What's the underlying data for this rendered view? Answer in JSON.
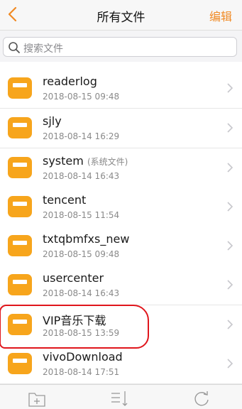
{
  "header": {
    "title": "所有文件",
    "edit_label": "编辑"
  },
  "search": {
    "placeholder": "搜索文件"
  },
  "files": [
    {
      "name": "readerlog",
      "date": "2018-08-15 09:48"
    },
    {
      "name": "sjly",
      "date": "2018-08-14 16:29"
    },
    {
      "name": "system",
      "tag": "(系统文件)",
      "date": "2018-08-14 16:43"
    },
    {
      "name": "tencent",
      "date": "2018-08-15 11:54"
    },
    {
      "name": "txtqbmfxs_new",
      "date": "2018-08-15 09:48"
    },
    {
      "name": "usercenter",
      "date": "2018-08-14 16:43"
    },
    {
      "name": "VIP音乐下载",
      "date": "2018-08-15 13:59"
    },
    {
      "name": "vivoDownload",
      "date": "2018-08-14 17:51"
    }
  ],
  "colors": {
    "accent": "#f08a24",
    "folder": "#f7a51c",
    "annotation": "#e0161c"
  },
  "icons": [
    "back-chevron-icon",
    "search-icon",
    "folder-icon",
    "chevron-right-icon",
    "new-folder-icon",
    "sort-icon",
    "refresh-icon"
  ]
}
